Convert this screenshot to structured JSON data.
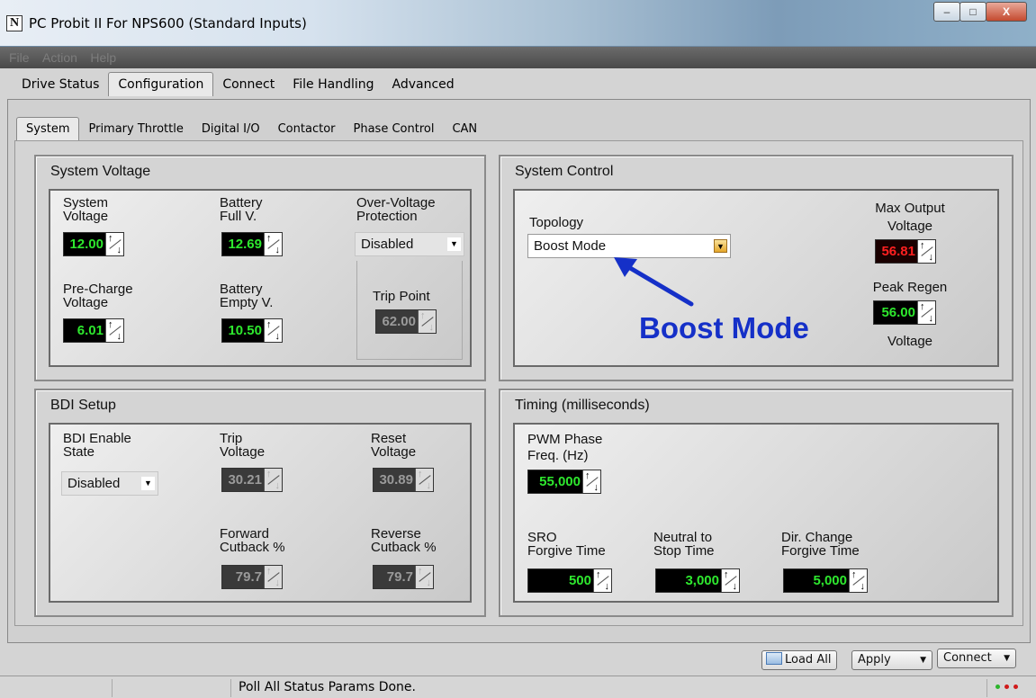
{
  "window": {
    "title": "PC Probit II  For NPS600 (Standard Inputs)",
    "controls": {
      "minimize": "–",
      "maximize": "□",
      "close": "X"
    }
  },
  "menu": [
    "File",
    "Action",
    "Help"
  ],
  "main_tabs": [
    "Drive Status",
    "Configuration",
    "Connect",
    "File Handling",
    "Advanced"
  ],
  "sub_tabs": [
    "System",
    "Primary Throttle",
    "Digital I/O",
    "Contactor",
    "Phase Control",
    "CAN"
  ],
  "system_voltage": {
    "title": "System Voltage",
    "system_voltage_label": [
      "System",
      "Voltage"
    ],
    "system_voltage_value": "12.00",
    "battery_full_label": [
      "Battery",
      "Full V."
    ],
    "battery_full_value": "12.69",
    "over_voltage_label": [
      "Over-Voltage",
      "Protection"
    ],
    "over_voltage_value": "Disabled",
    "pre_charge_label": [
      "Pre-Charge",
      "Voltage"
    ],
    "pre_charge_value": "6.01",
    "battery_empty_label": [
      "Battery",
      "Empty V."
    ],
    "battery_empty_value": "10.50",
    "trip_point_label": "Trip Point",
    "trip_point_value": "62.00"
  },
  "system_control": {
    "title": "System Control",
    "topology_label": "Topology",
    "topology_value": "Boost Mode",
    "max_output_label": [
      "Max Output",
      "Voltage"
    ],
    "max_output_value": "56.81",
    "peak_regen_label": "Peak Regen",
    "peak_regen_value": "56.00",
    "peak_regen_unit": "Voltage",
    "annotation": "Boost Mode"
  },
  "bdi_setup": {
    "title": "BDI Setup",
    "enable_label": [
      "BDI Enable",
      "State"
    ],
    "enable_value": "Disabled",
    "trip_label": [
      "Trip",
      "Voltage"
    ],
    "trip_value": "30.21",
    "reset_label": [
      "Reset",
      "Voltage"
    ],
    "reset_value": "30.89",
    "forward_label": [
      "Forward",
      "Cutback %"
    ],
    "forward_value": "79.7",
    "reverse_label": [
      "Reverse",
      "Cutback %"
    ],
    "reverse_value": "79.7"
  },
  "timing": {
    "title": "Timing (milliseconds)",
    "pwm_label": [
      "PWM Phase",
      "Freq. (Hz)"
    ],
    "pwm_value": "55,000",
    "sro_label": [
      "SRO",
      "Forgive Time"
    ],
    "sro_value": "500",
    "neutral_label": [
      "Neutral to",
      "Stop Time"
    ],
    "neutral_value": "3,000",
    "dir_label": [
      "Dir. Change",
      "Forgive Time"
    ],
    "dir_value": "5,000"
  },
  "toolbar": {
    "load_all": "Load All",
    "apply": "Apply",
    "connect": "Connect"
  },
  "status": {
    "message": "Poll All Status Params Done."
  },
  "colors": {
    "value_green": "#2ee82e",
    "value_red": "#ff2020",
    "annotation_blue": "#1530c8"
  }
}
